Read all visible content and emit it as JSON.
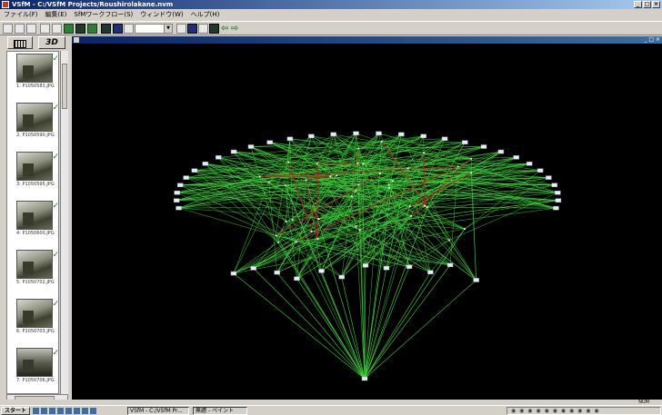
{
  "window": {
    "title": "VSfM - C:/VSfM Projects/Roushirolakane.nvm"
  },
  "menu": [
    "ファイル(F)",
    "編集(E)",
    "SfMワークフロー(S)",
    "ウィンドウ(W)",
    "ヘルプ(H)"
  ],
  "toolbar": {
    "combo_value": "",
    "back_arrow": "⇦",
    "forward_arrow": "⇨"
  },
  "view_tabs": {
    "three_d": "3D"
  },
  "thumbnails": [
    {
      "caption": "1: P1050583.JPG"
    },
    {
      "caption": "2: P1050590.JPG"
    },
    {
      "caption": "3: P1050595.JPG"
    },
    {
      "caption": "4: P1050600.JPG"
    },
    {
      "caption": "5: P1050702.JPG"
    },
    {
      "caption": "6: P1050703.JPG"
    },
    {
      "caption": "7: P1050706.JPG"
    }
  ],
  "status": {
    "right_text": "NUM"
  },
  "taskbar": {
    "start_label": "スタート",
    "tasks": [
      "VSfM - C:/VSfM Pr...",
      "無題 - ペイント"
    ]
  },
  "colors": {
    "edge": "#3ed43a",
    "edge_red": "#b3261e",
    "camera": "#e8eef5",
    "background": "#000000"
  }
}
